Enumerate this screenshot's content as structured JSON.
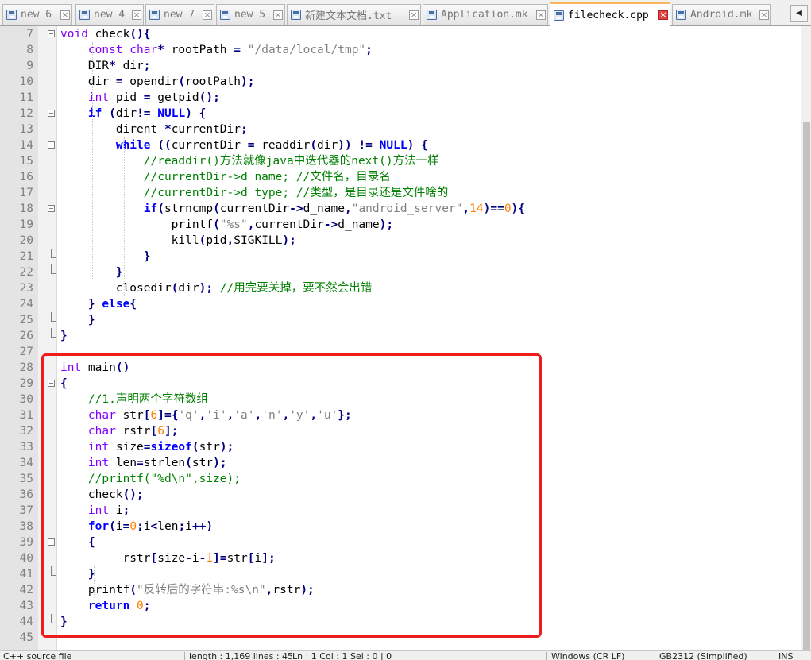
{
  "tabs": [
    {
      "label": "new 6",
      "active": false
    },
    {
      "label": "new 4",
      "active": false
    },
    {
      "label": "new 7",
      "active": false
    },
    {
      "label": "new 5",
      "active": false
    },
    {
      "label": "新建文本文档.txt",
      "active": false
    },
    {
      "label": "Application.mk",
      "active": false
    },
    {
      "label": "filecheck.cpp",
      "active": true
    },
    {
      "label": "Android.mk",
      "active": false
    }
  ],
  "tab_scroll_left": "◀",
  "lines": [
    {
      "n": "7",
      "fold": "box",
      "code": [
        [
          "kw2",
          "void"
        ],
        [
          "id",
          " check"
        ],
        [
          "op",
          "(){"
        ]
      ]
    },
    {
      "n": "8",
      "fold": "",
      "code": [
        [
          "id",
          "    "
        ],
        [
          "kw2",
          "const char"
        ],
        [
          "op",
          "*"
        ],
        [
          "id",
          " rootPath "
        ],
        [
          "op",
          "="
        ],
        [
          "id",
          " "
        ],
        [
          "str",
          "\"/data/local/tmp\""
        ],
        [
          "op",
          ";"
        ]
      ]
    },
    {
      "n": "9",
      "fold": "",
      "code": [
        [
          "id",
          "    DIR"
        ],
        [
          "op",
          "*"
        ],
        [
          "id",
          " dir"
        ],
        [
          "op",
          ";"
        ]
      ]
    },
    {
      "n": "10",
      "fold": "",
      "code": [
        [
          "id",
          "    dir "
        ],
        [
          "op",
          "="
        ],
        [
          "id",
          " opendir"
        ],
        [
          "op",
          "("
        ],
        [
          "id",
          "rootPath"
        ],
        [
          "op",
          ");"
        ]
      ]
    },
    {
      "n": "11",
      "fold": "",
      "code": [
        [
          "id",
          "    "
        ],
        [
          "kw2",
          "int"
        ],
        [
          "id",
          " pid "
        ],
        [
          "op",
          "="
        ],
        [
          "id",
          " getpid"
        ],
        [
          "op",
          "();"
        ]
      ]
    },
    {
      "n": "12",
      "fold": "box",
      "code": [
        [
          "id",
          "    "
        ],
        [
          "kw1",
          "if"
        ],
        [
          "id",
          " "
        ],
        [
          "op",
          "("
        ],
        [
          "id",
          "dir"
        ],
        [
          "op",
          "!="
        ],
        [
          "id",
          " "
        ],
        [
          "kw1",
          "NULL"
        ],
        [
          "op",
          ")"
        ],
        [
          "id",
          " "
        ],
        [
          "op",
          "{"
        ]
      ]
    },
    {
      "n": "13",
      "fold": "",
      "code": [
        [
          "id",
          "        dirent "
        ],
        [
          "op",
          "*"
        ],
        [
          "id",
          "currentDir"
        ],
        [
          "op",
          ";"
        ]
      ]
    },
    {
      "n": "14",
      "fold": "box",
      "code": [
        [
          "id",
          "        "
        ],
        [
          "kw1",
          "while"
        ],
        [
          "id",
          " "
        ],
        [
          "op",
          "(("
        ],
        [
          "id",
          "currentDir "
        ],
        [
          "op",
          "="
        ],
        [
          "id",
          " readdir"
        ],
        [
          "op",
          "("
        ],
        [
          "id",
          "dir"
        ],
        [
          "op",
          "))"
        ],
        [
          "id",
          " "
        ],
        [
          "op",
          "!="
        ],
        [
          "id",
          " "
        ],
        [
          "kw1",
          "NULL"
        ],
        [
          "op",
          ")"
        ],
        [
          "id",
          " "
        ],
        [
          "op",
          "{"
        ]
      ]
    },
    {
      "n": "15",
      "fold": "",
      "code": [
        [
          "id",
          "            "
        ],
        [
          "cm",
          "//readdir()方法就像java中迭代器的next()方法一样"
        ]
      ]
    },
    {
      "n": "16",
      "fold": "",
      "code": [
        [
          "id",
          "            "
        ],
        [
          "cm",
          "//currentDir->d_name; //文件名，目录名"
        ]
      ]
    },
    {
      "n": "17",
      "fold": "",
      "code": [
        [
          "id",
          "            "
        ],
        [
          "cm",
          "//currentDir->d_type; //类型，是目录还是文件啥的"
        ]
      ]
    },
    {
      "n": "18",
      "fold": "box",
      "code": [
        [
          "id",
          "            "
        ],
        [
          "kw1",
          "if"
        ],
        [
          "op",
          "("
        ],
        [
          "id",
          "strncmp"
        ],
        [
          "op",
          "("
        ],
        [
          "id",
          "currentDir"
        ],
        [
          "op",
          "->"
        ],
        [
          "id",
          "d_name"
        ],
        [
          "op",
          ","
        ],
        [
          "str",
          "\"android_server\""
        ],
        [
          "op",
          ","
        ],
        [
          "num",
          "14"
        ],
        [
          "op",
          ")=="
        ],
        [
          "num",
          "0"
        ],
        [
          "op",
          "){"
        ]
      ]
    },
    {
      "n": "19",
      "fold": "",
      "code": [
        [
          "id",
          "                printf"
        ],
        [
          "op",
          "("
        ],
        [
          "str",
          "\"%s\""
        ],
        [
          "op",
          ","
        ],
        [
          "id",
          "currentDir"
        ],
        [
          "op",
          "->"
        ],
        [
          "id",
          "d_name"
        ],
        [
          "op",
          ");"
        ]
      ]
    },
    {
      "n": "20",
      "fold": "",
      "code": [
        [
          "id",
          "                kill"
        ],
        [
          "op",
          "("
        ],
        [
          "id",
          "pid"
        ],
        [
          "op",
          ","
        ],
        [
          "id",
          "SIGKILL"
        ],
        [
          "op",
          ");"
        ]
      ]
    },
    {
      "n": "21",
      "fold": "end",
      "code": [
        [
          "id",
          "            "
        ],
        [
          "op",
          "}"
        ]
      ]
    },
    {
      "n": "22",
      "fold": "end",
      "code": [
        [
          "id",
          "        "
        ],
        [
          "op",
          "}"
        ]
      ]
    },
    {
      "n": "23",
      "fold": "",
      "code": [
        [
          "id",
          "        closedir"
        ],
        [
          "op",
          "("
        ],
        [
          "id",
          "dir"
        ],
        [
          "op",
          ");"
        ],
        [
          "id",
          " "
        ],
        [
          "cm",
          "//用完要关掉，要不然会出错"
        ]
      ]
    },
    {
      "n": "24",
      "fold": "",
      "code": [
        [
          "id",
          "    "
        ],
        [
          "op",
          "}"
        ],
        [
          "id",
          " "
        ],
        [
          "kw1",
          "else"
        ],
        [
          "op",
          "{"
        ]
      ]
    },
    {
      "n": "25",
      "fold": "end",
      "code": [
        [
          "id",
          "    "
        ],
        [
          "op",
          "}"
        ]
      ]
    },
    {
      "n": "26",
      "fold": "end",
      "code": [
        [
          "op",
          "}"
        ]
      ]
    },
    {
      "n": "27",
      "fold": "",
      "code": []
    },
    {
      "n": "28",
      "fold": "",
      "code": [
        [
          "kw2",
          "int"
        ],
        [
          "id",
          " main"
        ],
        [
          "op",
          "()"
        ]
      ]
    },
    {
      "n": "29",
      "fold": "box",
      "code": [
        [
          "op",
          "{"
        ]
      ]
    },
    {
      "n": "30",
      "fold": "",
      "code": [
        [
          "id",
          "    "
        ],
        [
          "cm",
          "//1.声明两个字符数组"
        ]
      ]
    },
    {
      "n": "31",
      "fold": "",
      "code": [
        [
          "id",
          "    "
        ],
        [
          "kw2",
          "char"
        ],
        [
          "id",
          " str"
        ],
        [
          "op",
          "["
        ],
        [
          "num",
          "6"
        ],
        [
          "op",
          "]={"
        ],
        [
          "str",
          "'q'"
        ],
        [
          "op",
          ","
        ],
        [
          "str",
          "'i'"
        ],
        [
          "op",
          ","
        ],
        [
          "str",
          "'a'"
        ],
        [
          "op",
          ","
        ],
        [
          "str",
          "'n'"
        ],
        [
          "op",
          ","
        ],
        [
          "str",
          "'y'"
        ],
        [
          "op",
          ","
        ],
        [
          "str",
          "'u'"
        ],
        [
          "op",
          "};"
        ]
      ]
    },
    {
      "n": "32",
      "fold": "",
      "code": [
        [
          "id",
          "    "
        ],
        [
          "kw2",
          "char"
        ],
        [
          "id",
          " rstr"
        ],
        [
          "op",
          "["
        ],
        [
          "num",
          "6"
        ],
        [
          "op",
          "];"
        ]
      ]
    },
    {
      "n": "33",
      "fold": "",
      "code": [
        [
          "id",
          "    "
        ],
        [
          "kw2",
          "int"
        ],
        [
          "id",
          " size"
        ],
        [
          "op",
          "="
        ],
        [
          "kw1",
          "sizeof"
        ],
        [
          "op",
          "("
        ],
        [
          "id",
          "str"
        ],
        [
          "op",
          ");"
        ]
      ]
    },
    {
      "n": "34",
      "fold": "",
      "code": [
        [
          "id",
          "    "
        ],
        [
          "kw2",
          "int"
        ],
        [
          "id",
          " len"
        ],
        [
          "op",
          "="
        ],
        [
          "id",
          "strlen"
        ],
        [
          "op",
          "("
        ],
        [
          "id",
          "str"
        ],
        [
          "op",
          ");"
        ]
      ]
    },
    {
      "n": "35",
      "fold": "",
      "code": [
        [
          "id",
          "    "
        ],
        [
          "cm",
          "//printf(\"%d\\n\",size);"
        ]
      ]
    },
    {
      "n": "36",
      "fold": "",
      "code": [
        [
          "id",
          "    check"
        ],
        [
          "op",
          "();"
        ]
      ]
    },
    {
      "n": "37",
      "fold": "",
      "code": [
        [
          "id",
          "    "
        ],
        [
          "kw2",
          "int"
        ],
        [
          "id",
          " i"
        ],
        [
          "op",
          ";"
        ]
      ]
    },
    {
      "n": "38",
      "fold": "",
      "code": [
        [
          "id",
          "    "
        ],
        [
          "kw1",
          "for"
        ],
        [
          "op",
          "("
        ],
        [
          "id",
          "i"
        ],
        [
          "op",
          "="
        ],
        [
          "num",
          "0"
        ],
        [
          "op",
          ";"
        ],
        [
          "id",
          "i"
        ],
        [
          "op",
          "<"
        ],
        [
          "id",
          "len"
        ],
        [
          "op",
          ";"
        ],
        [
          "id",
          "i"
        ],
        [
          "op",
          "++)"
        ]
      ]
    },
    {
      "n": "39",
      "fold": "box",
      "code": [
        [
          "id",
          "    "
        ],
        [
          "op",
          "{"
        ]
      ]
    },
    {
      "n": "40",
      "fold": "",
      "code": [
        [
          "id",
          "         rstr"
        ],
        [
          "op",
          "["
        ],
        [
          "id",
          "size"
        ],
        [
          "op",
          "-"
        ],
        [
          "id",
          "i"
        ],
        [
          "op",
          "-"
        ],
        [
          "num",
          "1"
        ],
        [
          "op",
          "]="
        ],
        [
          "id",
          "str"
        ],
        [
          "op",
          "["
        ],
        [
          "id",
          "i"
        ],
        [
          "op",
          "];"
        ]
      ]
    },
    {
      "n": "41",
      "fold": "end",
      "code": [
        [
          "id",
          "    "
        ],
        [
          "op",
          "}"
        ]
      ]
    },
    {
      "n": "42",
      "fold": "",
      "code": [
        [
          "id",
          "    printf"
        ],
        [
          "op",
          "("
        ],
        [
          "str",
          "\"反转后的字符串:%s\\n\""
        ],
        [
          "op",
          ","
        ],
        [
          "id",
          "rstr"
        ],
        [
          "op",
          ");"
        ]
      ]
    },
    {
      "n": "43",
      "fold": "",
      "code": [
        [
          "id",
          "    "
        ],
        [
          "kw1",
          "return"
        ],
        [
          "id",
          " "
        ],
        [
          "num",
          "0"
        ],
        [
          "op",
          ";"
        ]
      ]
    },
    {
      "n": "44",
      "fold": "end",
      "code": [
        [
          "op",
          "}"
        ]
      ]
    },
    {
      "n": "45",
      "fold": "",
      "code": []
    }
  ],
  "status": {
    "file_type": "C++ source file",
    "length_lines": "length : 1,169    lines : 45",
    "position": "Ln : 1    Col : 1    Sel : 0 | 0",
    "eol": "Windows (CR LF)",
    "encoding": "GB2312 (Simplified)",
    "mode": "INS"
  },
  "colors": {
    "highlight_box": "#ee1c1c",
    "active_tab_accent": "#fab45a",
    "keyword_type": "#8000ff",
    "keyword": "#0000ff",
    "operator": "#000080",
    "string": "#808080",
    "number": "#ff8000",
    "comment": "#008000"
  }
}
